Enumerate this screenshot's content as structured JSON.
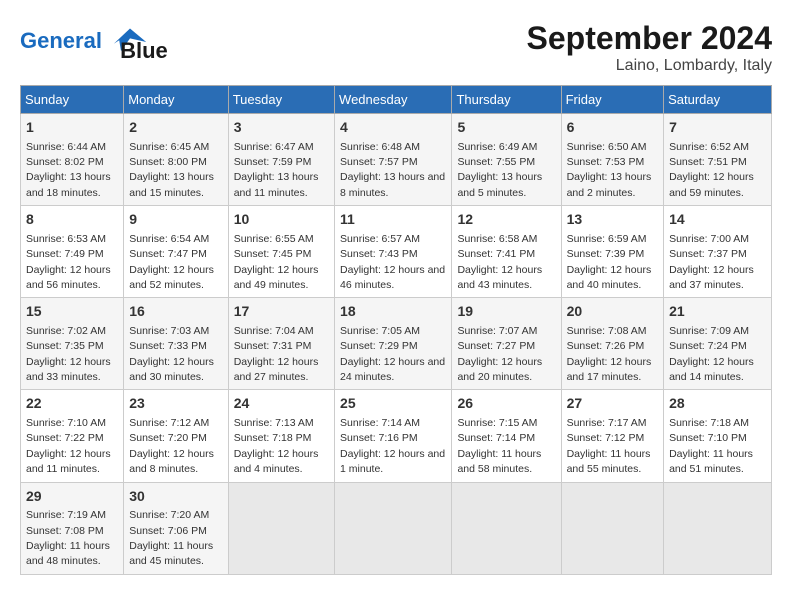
{
  "header": {
    "logo_line1": "General",
    "logo_line2": "Blue",
    "month_title": "September 2024",
    "location": "Laino, Lombardy, Italy"
  },
  "weekdays": [
    "Sunday",
    "Monday",
    "Tuesday",
    "Wednesday",
    "Thursday",
    "Friday",
    "Saturday"
  ],
  "weeks": [
    [
      {
        "day": "1",
        "sunrise": "6:44 AM",
        "sunset": "8:02 PM",
        "daylight": "13 hours and 18 minutes."
      },
      {
        "day": "2",
        "sunrise": "6:45 AM",
        "sunset": "8:00 PM",
        "daylight": "13 hours and 15 minutes."
      },
      {
        "day": "3",
        "sunrise": "6:47 AM",
        "sunset": "7:59 PM",
        "daylight": "13 hours and 11 minutes."
      },
      {
        "day": "4",
        "sunrise": "6:48 AM",
        "sunset": "7:57 PM",
        "daylight": "13 hours and 8 minutes."
      },
      {
        "day": "5",
        "sunrise": "6:49 AM",
        "sunset": "7:55 PM",
        "daylight": "13 hours and 5 minutes."
      },
      {
        "day": "6",
        "sunrise": "6:50 AM",
        "sunset": "7:53 PM",
        "daylight": "13 hours and 2 minutes."
      },
      {
        "day": "7",
        "sunrise": "6:52 AM",
        "sunset": "7:51 PM",
        "daylight": "12 hours and 59 minutes."
      }
    ],
    [
      {
        "day": "8",
        "sunrise": "6:53 AM",
        "sunset": "7:49 PM",
        "daylight": "12 hours and 56 minutes."
      },
      {
        "day": "9",
        "sunrise": "6:54 AM",
        "sunset": "7:47 PM",
        "daylight": "12 hours and 52 minutes."
      },
      {
        "day": "10",
        "sunrise": "6:55 AM",
        "sunset": "7:45 PM",
        "daylight": "12 hours and 49 minutes."
      },
      {
        "day": "11",
        "sunrise": "6:57 AM",
        "sunset": "7:43 PM",
        "daylight": "12 hours and 46 minutes."
      },
      {
        "day": "12",
        "sunrise": "6:58 AM",
        "sunset": "7:41 PM",
        "daylight": "12 hours and 43 minutes."
      },
      {
        "day": "13",
        "sunrise": "6:59 AM",
        "sunset": "7:39 PM",
        "daylight": "12 hours and 40 minutes."
      },
      {
        "day": "14",
        "sunrise": "7:00 AM",
        "sunset": "7:37 PM",
        "daylight": "12 hours and 37 minutes."
      }
    ],
    [
      {
        "day": "15",
        "sunrise": "7:02 AM",
        "sunset": "7:35 PM",
        "daylight": "12 hours and 33 minutes."
      },
      {
        "day": "16",
        "sunrise": "7:03 AM",
        "sunset": "7:33 PM",
        "daylight": "12 hours and 30 minutes."
      },
      {
        "day": "17",
        "sunrise": "7:04 AM",
        "sunset": "7:31 PM",
        "daylight": "12 hours and 27 minutes."
      },
      {
        "day": "18",
        "sunrise": "7:05 AM",
        "sunset": "7:29 PM",
        "daylight": "12 hours and 24 minutes."
      },
      {
        "day": "19",
        "sunrise": "7:07 AM",
        "sunset": "7:27 PM",
        "daylight": "12 hours and 20 minutes."
      },
      {
        "day": "20",
        "sunrise": "7:08 AM",
        "sunset": "7:26 PM",
        "daylight": "12 hours and 17 minutes."
      },
      {
        "day": "21",
        "sunrise": "7:09 AM",
        "sunset": "7:24 PM",
        "daylight": "12 hours and 14 minutes."
      }
    ],
    [
      {
        "day": "22",
        "sunrise": "7:10 AM",
        "sunset": "7:22 PM",
        "daylight": "12 hours and 11 minutes."
      },
      {
        "day": "23",
        "sunrise": "7:12 AM",
        "sunset": "7:20 PM",
        "daylight": "12 hours and 8 minutes."
      },
      {
        "day": "24",
        "sunrise": "7:13 AM",
        "sunset": "7:18 PM",
        "daylight": "12 hours and 4 minutes."
      },
      {
        "day": "25",
        "sunrise": "7:14 AM",
        "sunset": "7:16 PM",
        "daylight": "12 hours and 1 minute."
      },
      {
        "day": "26",
        "sunrise": "7:15 AM",
        "sunset": "7:14 PM",
        "daylight": "11 hours and 58 minutes."
      },
      {
        "day": "27",
        "sunrise": "7:17 AM",
        "sunset": "7:12 PM",
        "daylight": "11 hours and 55 minutes."
      },
      {
        "day": "28",
        "sunrise": "7:18 AM",
        "sunset": "7:10 PM",
        "daylight": "11 hours and 51 minutes."
      }
    ],
    [
      {
        "day": "29",
        "sunrise": "7:19 AM",
        "sunset": "7:08 PM",
        "daylight": "11 hours and 48 minutes."
      },
      {
        "day": "30",
        "sunrise": "7:20 AM",
        "sunset": "7:06 PM",
        "daylight": "11 hours and 45 minutes."
      },
      null,
      null,
      null,
      null,
      null
    ]
  ]
}
